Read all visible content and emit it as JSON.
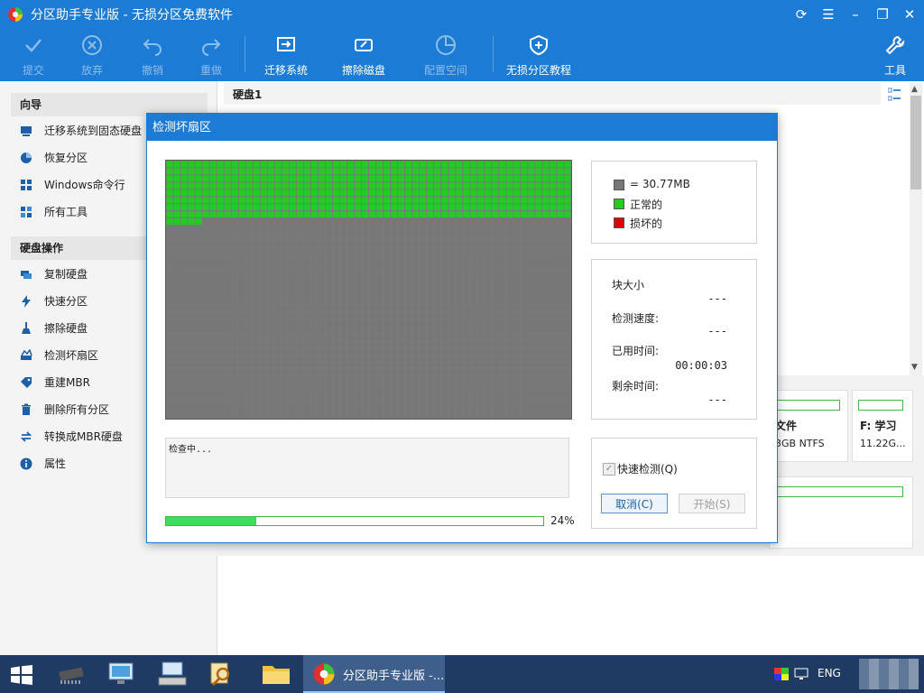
{
  "window": {
    "title": "分区助手专业版 - 无损分区免费软件",
    "controls": [
      "refresh-icon",
      "menu-icon",
      "minimize-icon",
      "restore-icon",
      "close-icon"
    ]
  },
  "toolbar": {
    "items": [
      {
        "label": "提交",
        "icon": "check-icon",
        "enabled": false
      },
      {
        "label": "放弃",
        "icon": "discard-icon",
        "enabled": false
      },
      {
        "label": "撤销",
        "icon": "undo-icon",
        "enabled": false
      },
      {
        "label": "重做",
        "icon": "redo-icon",
        "enabled": false
      },
      {
        "label": "迁移系统",
        "icon": "migrate-icon",
        "enabled": true
      },
      {
        "label": "擦除磁盘",
        "icon": "wipe-disk-icon",
        "enabled": true
      },
      {
        "label": "配置空间",
        "icon": "allocate-space-icon",
        "enabled": false
      },
      {
        "label": "无损分区教程",
        "icon": "shield-icon",
        "enabled": true
      },
      {
        "label": "工具",
        "icon": "tools-icon",
        "enabled": true
      }
    ]
  },
  "sidebar": {
    "wizard_heading": "向导",
    "wizard_items": [
      {
        "label": "迁移系统到固态硬盘",
        "icon": "ssd-icon"
      },
      {
        "label": "恢复分区",
        "icon": "recover-icon"
      },
      {
        "label": "Windows命令行",
        "icon": "windows-icon"
      },
      {
        "label": "所有工具",
        "icon": "grid-icon"
      }
    ],
    "disk_heading": "硬盘操作",
    "disk_items": [
      {
        "label": "复制硬盘",
        "icon": "copy-disk-icon"
      },
      {
        "label": "快速分区",
        "icon": "lightning-icon"
      },
      {
        "label": "擦除硬盘",
        "icon": "broom-icon"
      },
      {
        "label": "检测坏扇区",
        "icon": "scan-icon"
      },
      {
        "label": "重建MBR",
        "icon": "tag-icon"
      },
      {
        "label": "删除所有分区",
        "icon": "trash-icon"
      },
      {
        "label": "转换成MBR硬盘",
        "icon": "convert-icon"
      },
      {
        "label": "属性",
        "icon": "info-icon"
      }
    ]
  },
  "disk_panel": {
    "disk_label": "硬盘1",
    "partitions": [
      {
        "name_fragment": "文件",
        "detail_fragment": "3GB NTFS"
      },
      {
        "name": "F: 学习",
        "detail": "11.22G..."
      }
    ]
  },
  "dialog": {
    "title": "检测坏扇区",
    "legend": [
      {
        "label": "= 30.77MB",
        "color": "#777777"
      },
      {
        "label": "正常的",
        "color": "#22cc22"
      },
      {
        "label": "损坏的",
        "color": "#dd0000"
      }
    ],
    "scan_grid": {
      "columns": 56,
      "rows": 36,
      "blocks_scanned": 453
    },
    "info": {
      "block_size_label": "块大小",
      "block_size_value": "---",
      "speed_label": "检测速度:",
      "speed_value": "---",
      "elapsed_label": "已用时间:",
      "elapsed_value": "00:00:03",
      "remaining_label": "剩余时间:",
      "remaining_value": "---"
    },
    "log_text": "检查中...",
    "progress_percent": 24,
    "progress_label": "24%",
    "quick_check_label": "快速检测(Q)",
    "quick_check_checked": true,
    "cancel_label": "取消(C)",
    "start_label": "开始(S)"
  },
  "taskbar": {
    "items": [
      "windows-start-icon",
      "chip-icon",
      "network-pc-icon",
      "keyboard-pc-icon",
      "search-doc-icon",
      "folder-icon"
    ],
    "active_window_label": "分区助手专业版 -...",
    "language": "ENG"
  },
  "colors": {
    "accent": "#1c7bd4",
    "good": "#22cc22",
    "bad": "#dd0000",
    "unscanned": "#777777",
    "progress": "#3ddc5c"
  }
}
